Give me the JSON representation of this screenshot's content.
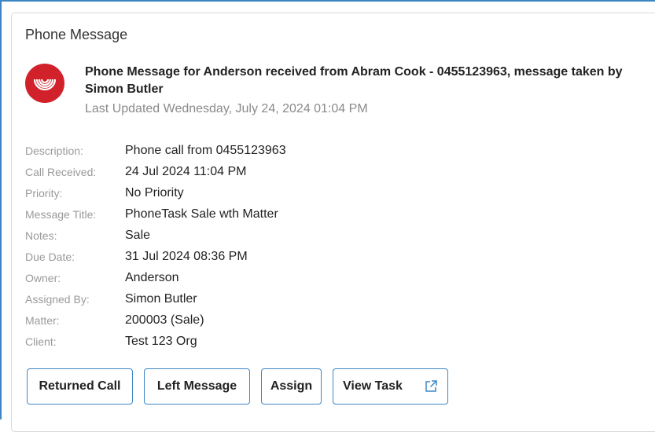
{
  "card": {
    "title": "Phone Message",
    "headline": "Phone Message for Anderson received from Abram Cook - 0455123963, message taken by Simon Butler",
    "last_updated": "Last Updated Wednesday, July 24, 2024 01:04 PM",
    "logo_icon": "phone-message-logo-icon",
    "logo_color": "#d1222b"
  },
  "details": [
    {
      "label": "Description:",
      "value": "Phone call from 0455123963"
    },
    {
      "label": "Call Received:",
      "value": "24 Jul 2024 11:04 PM"
    },
    {
      "label": "Priority:",
      "value": "No Priority"
    },
    {
      "label": "Message Title:",
      "value": "PhoneTask Sale wth Matter"
    },
    {
      "label": "Notes:",
      "value": "Sale"
    },
    {
      "label": "Due Date:",
      "value": "31 Jul 2024 08:36 PM"
    },
    {
      "label": "Owner:",
      "value": "Anderson"
    },
    {
      "label": "Assigned By:",
      "value": "Simon Butler"
    },
    {
      "label": "Matter:",
      "value": "200003 (Sale)"
    },
    {
      "label": "Client:",
      "value": "Test 123 Org"
    }
  ],
  "actions": {
    "returned_call": "Returned Call",
    "left_message": "Left Message",
    "assign": "Assign",
    "view_task": "View Task",
    "view_task_icon": "external-link-icon"
  },
  "colors": {
    "accent": "#3d86c6",
    "label": "#9a9a9a",
    "text": "#222222"
  }
}
